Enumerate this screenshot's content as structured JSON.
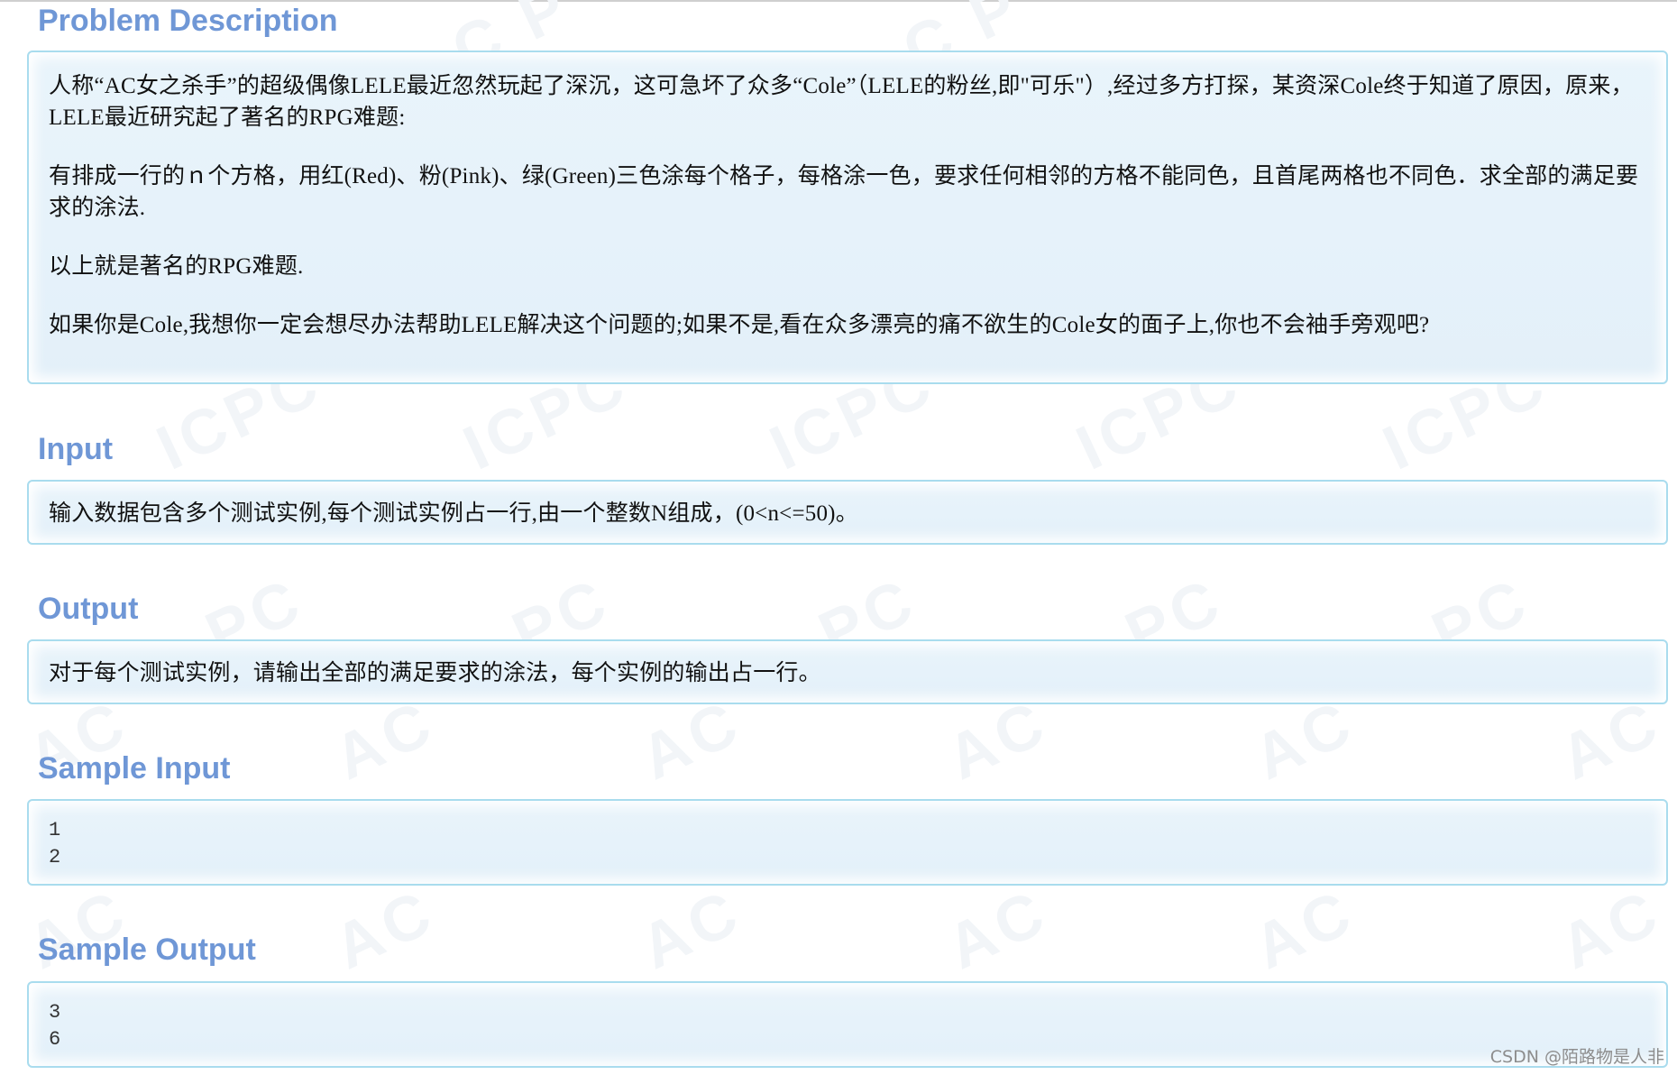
{
  "sections": {
    "description": {
      "title": "Problem Description",
      "paragraphs": [
        "人称“AC女之杀手”的超级偶像LELE最近忽然玩起了深沉，这可急坏了众多“Cole”（LELE的粉丝,即\"可乐\"）,经过多方打探，某资深Cole终于知道了原因，原来，LELE最近研究起了著名的RPG难题:",
        "有排成一行的ｎ个方格，用红(Red)、粉(Pink)、绿(Green)三色涂每个格子，每格涂一色，要求任何相邻的方格不能同色，且首尾两格也不同色．求全部的满足要求的涂法.",
        "以上就是著名的RPG难题.",
        "如果你是Cole,我想你一定会想尽办法帮助LELE解决这个问题的;如果不是,看在众多漂亮的痛不欲生的Cole女的面子上,你也不会袖手旁观吧?"
      ]
    },
    "input": {
      "title": "Input",
      "text": "输入数据包含多个测试实例,每个测试实例占一行,由一个整数N组成，(0<n<=50)。"
    },
    "output": {
      "title": "Output",
      "text": "对于每个测试实例，请输出全部的满足要求的涂法，每个实例的输出占一行。"
    },
    "sample_input": {
      "title": "Sample Input",
      "text": "1\n2"
    },
    "sample_output": {
      "title": "Sample Output",
      "text": "3\n6"
    }
  },
  "footer": {
    "credit": "CSDN @陌路物是人非"
  },
  "colors": {
    "title": "#6f97d6",
    "box_border": "#a9dcee",
    "box_fill": "#e6f2fa"
  }
}
